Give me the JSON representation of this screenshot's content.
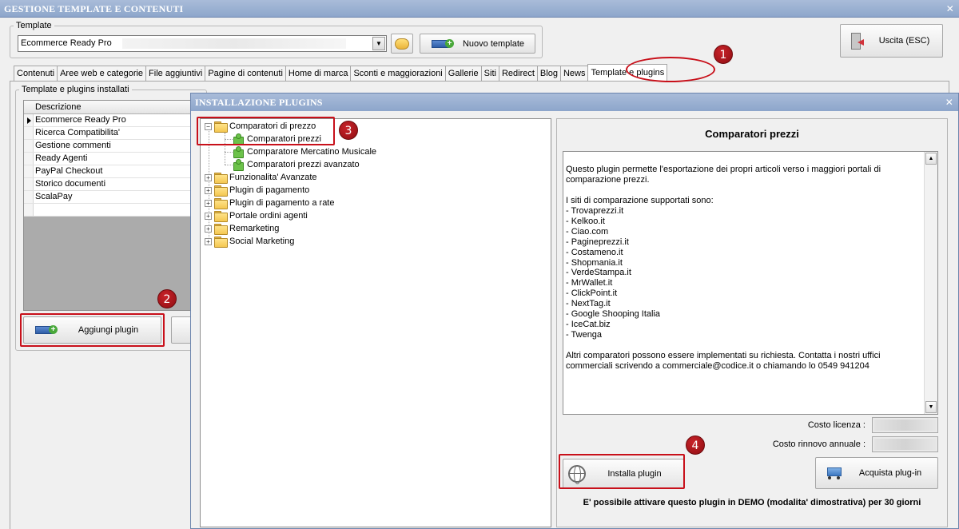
{
  "main_window": {
    "title": "GESTIONE TEMPLATE E CONTENUTI",
    "close_glyph": "✕"
  },
  "template_group": {
    "label": "Template",
    "selected": "Ecommerce Ready Pro",
    "folder_icon": "folder-icon",
    "new_template_label": "Nuovo template"
  },
  "exit_button": {
    "label": "Uscita (ESC)",
    "icon": "exit-door-icon"
  },
  "tabs": [
    {
      "label": "Contenuti"
    },
    {
      "label": "Aree web e categorie"
    },
    {
      "label": "File aggiuntivi"
    },
    {
      "label": "Pagine di contenuti"
    },
    {
      "label": "Home di marca"
    },
    {
      "label": "Sconti e maggiorazioni"
    },
    {
      "label": "Gallerie"
    },
    {
      "label": "Siti"
    },
    {
      "label": "Redirect"
    },
    {
      "label": "Blog"
    },
    {
      "label": "News"
    },
    {
      "label": "Template e plugins"
    }
  ],
  "installed_group": {
    "label": "Template e plugins installati",
    "column": "Descrizione",
    "rows": [
      "Ecommerce Ready Pro",
      "Ricerca Compatibilita'",
      "Gestione commenti",
      "Ready Agenti",
      "PayPal Checkout",
      "Storico documenti",
      "ScalaPay"
    ],
    "add_plugin_label": "Aggiungi plugin"
  },
  "callouts": [
    "1",
    "2",
    "3",
    "4"
  ],
  "dialog": {
    "title": "INSTALLAZIONE PLUGINS",
    "close_glyph": "✕",
    "tree": {
      "expanded": {
        "label": "Comparatori di prezzo",
        "children": [
          "Comparatori prezzi",
          "Comparatore Mercatino Musicale",
          "Comparatori prezzi avanzato"
        ]
      },
      "collapsed": [
        "Funzionalita' Avanzate",
        "Plugin di pagamento",
        "Plugin di pagamento a rate",
        "Portale ordini agenti",
        "Remarketing",
        "Social Marketing"
      ]
    },
    "details": {
      "title": "Comparatori prezzi",
      "description": "Questo plugin permette l'esportazione dei propri articoli verso i maggiori portali di comparazione prezzi.\n\nI siti di comparazione supportati sono:\n- Trovaprezzi.it\n- Kelkoo.it\n- Ciao.com\n- Pagineprezzi.it\n- Costameno.it\n- Shopmania.it\n- VerdeStampa.it\n- MrWallet.it\n- ClickPoint.it\n- NextTag.it\n- Google Shooping Italia\n- IceCat.biz\n- Twenga\n\nAltri comparatori possono essere implementati su richiesta. Contatta i nostri uffici commerciali scrivendo a commerciale@codice.it o chiamando lo 0549 941204",
      "license_cost_label": "Costo licenza :",
      "renewal_cost_label": "Costo rinnovo annuale :",
      "install_label": "Installa plugin",
      "buy_label": "Acquista plug-in",
      "demo_note": "E' possibile attivare questo plugin in DEMO (modalita' dimostrativa) per 30 giorni"
    }
  },
  "colors": {
    "titlebar": "#8da6cb",
    "callout_red": "#c8101a",
    "window_bg": "#f0f0f0"
  }
}
